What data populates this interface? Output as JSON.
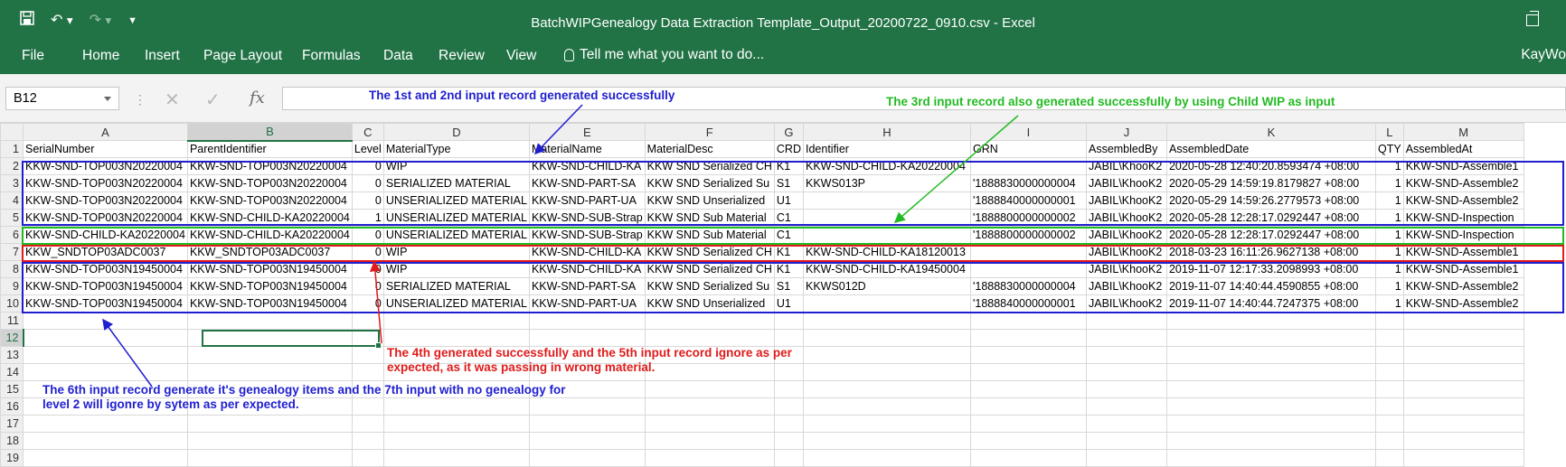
{
  "window": {
    "title": "BatchWIPGenealogy Data Extraction Template_Output_20200722_0910.csv - Excel",
    "qat_icons": [
      "save-icon",
      "undo-icon",
      "redo-icon",
      "customize-icon"
    ]
  },
  "ribbon": {
    "tabs": [
      "File",
      "Home",
      "Insert",
      "Page Layout",
      "Formulas",
      "Data",
      "Review",
      "View"
    ],
    "tell_me": "Tell me what you want to do...",
    "user": "KayWo"
  },
  "formula_bar": {
    "name_box": "B12",
    "formula": ""
  },
  "sheet": {
    "columns": [
      "A",
      "B",
      "C",
      "D",
      "E",
      "F",
      "G",
      "H",
      "I",
      "J",
      "K",
      "L",
      "M"
    ],
    "selected_column": "B",
    "selected_row": "12",
    "rows": [
      {
        "n": "1",
        "cells": [
          "SerialNumber",
          "ParentIdentifier",
          "Level",
          "MaterialType",
          "MaterialName",
          "MaterialDesc",
          "CRD",
          "Identifier",
          "GRN",
          "AssembledBy",
          "AssembledDate",
          "QTY",
          "AssembledAt"
        ]
      },
      {
        "n": "2",
        "cells": [
          "KKW-SND-TOP003N20220004",
          "KKW-SND-TOP003N20220004",
          "0",
          "WIP",
          "KKW-SND-CHILD-KA",
          "KKW SND Serialized CH",
          "K1",
          "KKW-SND-CHILD-KA20220004",
          "",
          "JABIL\\KhooK2",
          "2020-05-28 12:40:20.8593474 +08:00",
          "1",
          "KKW-SND-Assemble1"
        ]
      },
      {
        "n": "3",
        "cells": [
          "KKW-SND-TOP003N20220004",
          "KKW-SND-TOP003N20220004",
          "0",
          "SERIALIZED MATERIAL",
          "KKW-SND-PART-SA",
          "KKW SND Serialized Su",
          "S1",
          "KKWS013P",
          "'1888830000000004",
          "JABIL\\KhooK2",
          "2020-05-29 14:59:19.8179827 +08:00",
          "1",
          "KKW-SND-Assemble2"
        ]
      },
      {
        "n": "4",
        "cells": [
          "KKW-SND-TOP003N20220004",
          "KKW-SND-TOP003N20220004",
          "0",
          "UNSERIALIZED MATERIAL",
          "KKW-SND-PART-UA",
          "KKW SND Unserialized",
          "U1",
          "",
          "'1888840000000001",
          "JABIL\\KhooK2",
          "2020-05-29 14:59:26.2779573 +08:00",
          "1",
          "KKW-SND-Assemble2"
        ]
      },
      {
        "n": "5",
        "cells": [
          "KKW-SND-TOP003N20220004",
          "KKW-SND-CHILD-KA20220004",
          "1",
          "UNSERIALIZED MATERIAL",
          "KKW-SND-SUB-Strap",
          "KKW SND Sub Material",
          "C1",
          "",
          "'1888800000000002",
          "JABIL\\KhooK2",
          "2020-05-28 12:28:17.0292447 +08:00",
          "1",
          "KKW-SND-Inspection"
        ]
      },
      {
        "n": "6",
        "cells": [
          "KKW-SND-CHILD-KA20220004",
          "KKW-SND-CHILD-KA20220004",
          "0",
          "UNSERIALIZED MATERIAL",
          "KKW-SND-SUB-Strap",
          "KKW SND Sub Material",
          "C1",
          "",
          "'1888800000000002",
          "JABIL\\KhooK2",
          "2020-05-28 12:28:17.0292447 +08:00",
          "1",
          "KKW-SND-Inspection"
        ]
      },
      {
        "n": "7",
        "cells": [
          "KKW_SNDTOP03ADC0037",
          "KKW_SNDTOP03ADC0037",
          "0",
          "WIP",
          "KKW-SND-CHILD-KA",
          "KKW SND Serialized CH",
          "K1",
          "KKW-SND-CHILD-KA18120013",
          "",
          "JABIL\\KhooK2",
          "2018-03-23 16:11:26.9627138 +08:00",
          "1",
          "KKW-SND-Assemble1"
        ]
      },
      {
        "n": "8",
        "cells": [
          "KKW-SND-TOP003N19450004",
          "KKW-SND-TOP003N19450004",
          "0",
          "WIP",
          "KKW-SND-CHILD-KA",
          "KKW SND Serialized CH",
          "K1",
          "KKW-SND-CHILD-KA19450004",
          "",
          "JABIL\\KhooK2",
          "2019-11-07 12:17:33.2098993 +08:00",
          "1",
          "KKW-SND-Assemble1"
        ]
      },
      {
        "n": "9",
        "cells": [
          "KKW-SND-TOP003N19450004",
          "KKW-SND-TOP003N19450004",
          "0",
          "SERIALIZED MATERIAL",
          "KKW-SND-PART-SA",
          "KKW SND Serialized Su",
          "S1",
          "KKWS012D",
          "'1888830000000004",
          "JABIL\\KhooK2",
          "2019-11-07 14:40:44.4590855 +08:00",
          "1",
          "KKW-SND-Assemble2"
        ]
      },
      {
        "n": "10",
        "cells": [
          "KKW-SND-TOP003N19450004",
          "KKW-SND-TOP003N19450004",
          "0",
          "UNSERIALIZED MATERIAL",
          "KKW-SND-PART-UA",
          "KKW SND Unserialized",
          "U1",
          "",
          "'1888840000000001",
          "JABIL\\KhooK2",
          "2019-11-07 14:40:44.7247375 +08:00",
          "1",
          "KKW-SND-Assemble2"
        ]
      },
      {
        "n": "11",
        "cells": [
          "",
          "",
          "",
          "",
          "",
          "",
          "",
          "",
          "",
          "",
          "",
          "",
          ""
        ]
      },
      {
        "n": "12",
        "cells": [
          "",
          "",
          "",
          "",
          "",
          "",
          "",
          "",
          "",
          "",
          "",
          "",
          ""
        ]
      },
      {
        "n": "13",
        "cells": [
          "",
          "",
          "",
          "",
          "",
          "",
          "",
          "",
          "",
          "",
          "",
          "",
          ""
        ]
      },
      {
        "n": "14",
        "cells": [
          "",
          "",
          "",
          "",
          "",
          "",
          "",
          "",
          "",
          "",
          "",
          "",
          ""
        ]
      },
      {
        "n": "15",
        "cells": [
          "",
          "",
          "",
          "",
          "",
          "",
          "",
          "",
          "",
          "",
          "",
          "",
          ""
        ]
      },
      {
        "n": "16",
        "cells": [
          "",
          "",
          "",
          "",
          "",
          "",
          "",
          "",
          "",
          "",
          "",
          "",
          ""
        ]
      },
      {
        "n": "17",
        "cells": [
          "",
          "",
          "",
          "",
          "",
          "",
          "",
          "",
          "",
          "",
          "",
          "",
          ""
        ]
      },
      {
        "n": "18",
        "cells": [
          "",
          "",
          "",
          "",
          "",
          "",
          "",
          "",
          "",
          "",
          "",
          "",
          ""
        ]
      },
      {
        "n": "19",
        "cells": [
          "",
          "",
          "",
          "",
          "",
          "",
          "",
          "",
          "",
          "",
          "",
          "",
          ""
        ]
      }
    ]
  },
  "annotations": {
    "note_blue_top": "The 1st and 2nd input record generated successfully",
    "note_green": "The 3rd input record also generated successfully by using Child WIP as input",
    "note_red_line1": "The 4th generated successfully and the 5th input record ignore as per",
    "note_red_line2": "expected, as it was passing in wrong material.",
    "note_blue_bottom_line1": "The 6th input record generate it's genealogy items and the 7th input with no genealogy for",
    "note_blue_bottom_line2": "level 2 will igonre by sytem as per expected.",
    "colors": {
      "blue": "#1f1fd0",
      "green": "#22bb22",
      "red": "#e01b1b",
      "excel_green": "#217346"
    }
  }
}
